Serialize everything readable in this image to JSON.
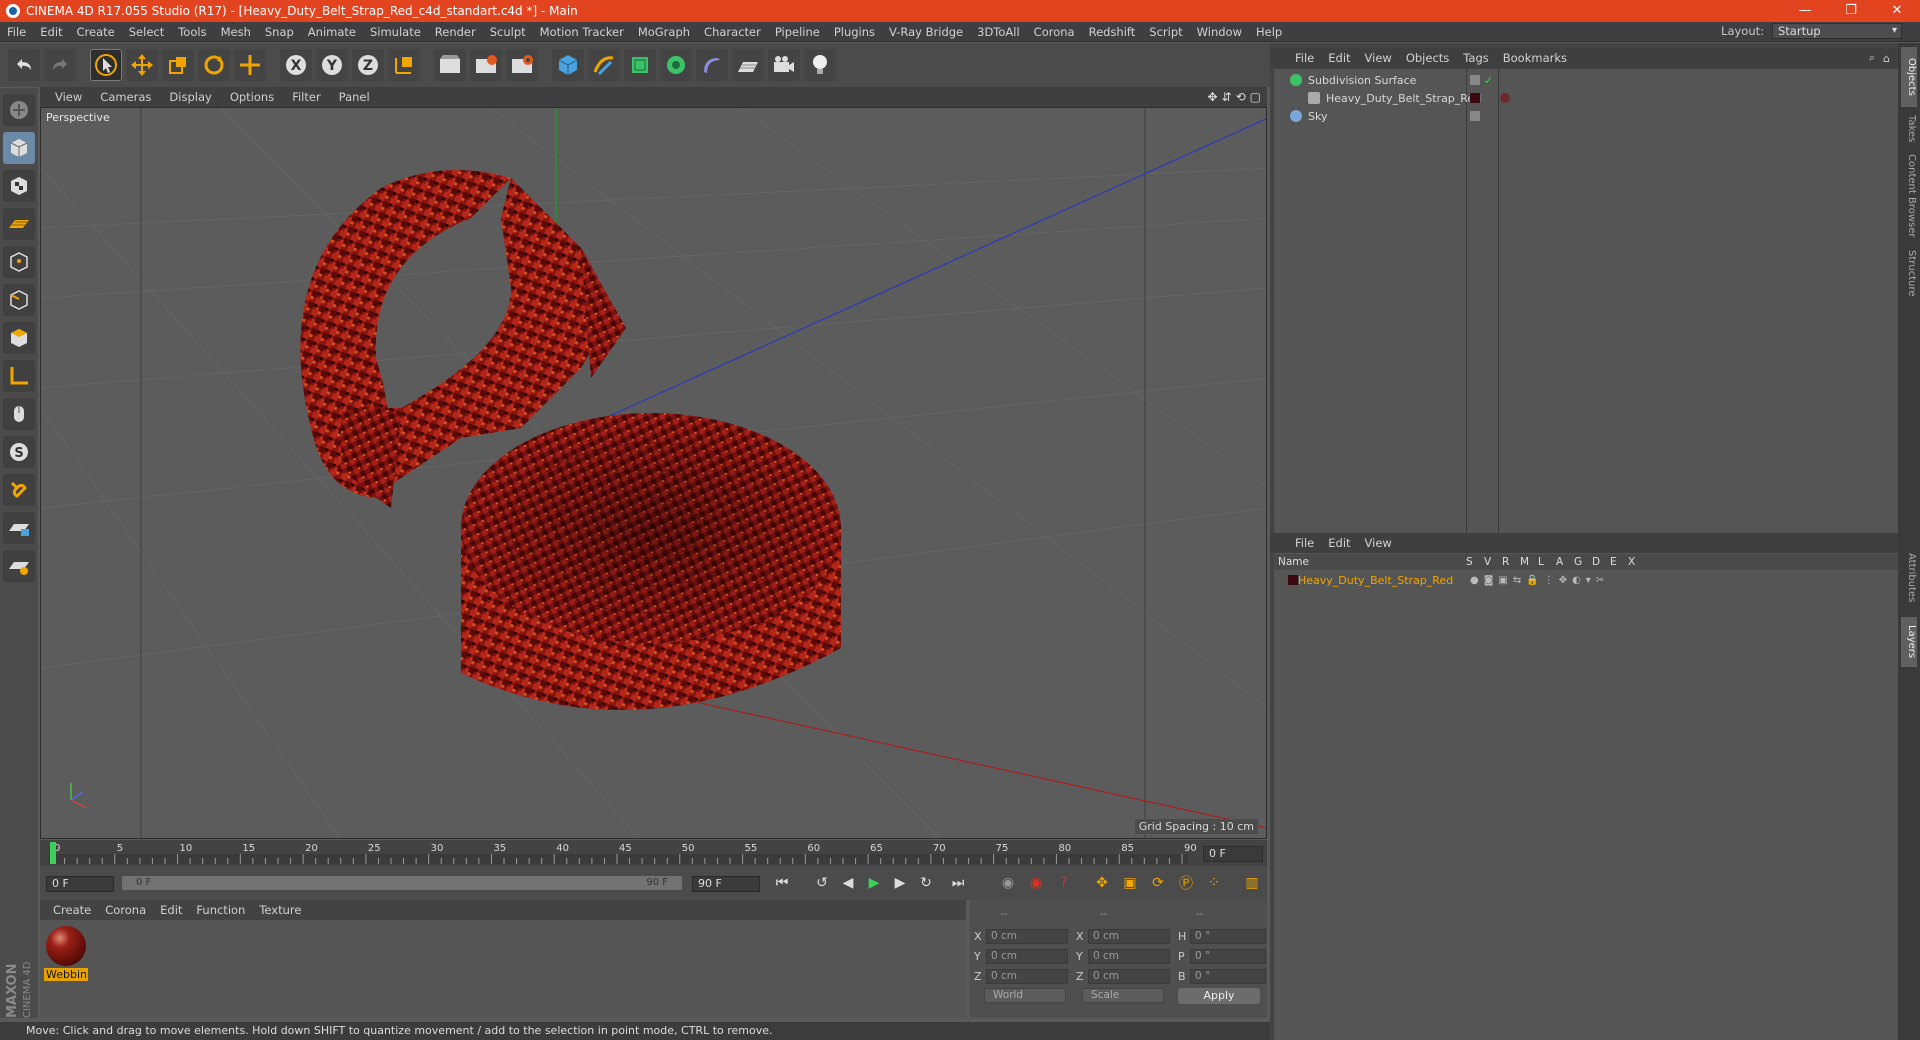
{
  "titlebar": {
    "title": "CINEMA 4D R17.055 Studio (R17) - [Heavy_Duty_Belt_Strap_Red_c4d_standart.c4d *] - Main",
    "controls": [
      "—",
      "❐",
      "✕"
    ]
  },
  "menubar": {
    "items": [
      "File",
      "Edit",
      "Create",
      "Select",
      "Tools",
      "Mesh",
      "Snap",
      "Animate",
      "Simulate",
      "Render",
      "Sculpt",
      "Motion Tracker",
      "MoGraph",
      "Character",
      "Pipeline",
      "Plugins",
      "V-Ray Bridge",
      "3DToAll",
      "Corona",
      "Redshift",
      "Script",
      "Window",
      "Help"
    ],
    "layout_label": "Layout:",
    "layout_value": "Startup"
  },
  "viewport": {
    "menu": [
      "View",
      "Cameras",
      "Display",
      "Options",
      "Filter",
      "Panel"
    ],
    "camera_label": "Perspective",
    "grid_spacing": "Grid Spacing : 10 cm",
    "nav_icons": [
      "✥",
      "⇵",
      "⟲",
      "▢"
    ]
  },
  "timeline": {
    "ticks": [
      "0",
      "5",
      "10",
      "15",
      "20",
      "25",
      "30",
      "35",
      "40",
      "45",
      "50",
      "55",
      "60",
      "65",
      "70",
      "75",
      "80",
      "85",
      "90"
    ],
    "current_frame": "0 F"
  },
  "playbar": {
    "start": "0 F",
    "range_start": "0 F",
    "range_end": "90 F",
    "end": "90 F"
  },
  "materials": {
    "menu": [
      "Create",
      "Corona",
      "Edit",
      "Function",
      "Texture"
    ],
    "items": [
      {
        "name": "Webbin"
      }
    ]
  },
  "coords": {
    "headers": [
      "--",
      "--",
      "--"
    ],
    "rows": [
      {
        "a": "X",
        "av": "0 cm",
        "b": "X",
        "bv": "0 cm",
        "c": "H",
        "cv": "0 °"
      },
      {
        "a": "Y",
        "av": "0 cm",
        "b": "Y",
        "bv": "0 cm",
        "c": "P",
        "cv": "0 °"
      },
      {
        "a": "Z",
        "av": "0 cm",
        "b": "Z",
        "bv": "0 cm",
        "c": "B",
        "cv": "0 °"
      }
    ],
    "mode1": "World",
    "mode2": "Scale",
    "apply": "Apply"
  },
  "objects": {
    "menu": [
      "File",
      "Edit",
      "View",
      "Objects",
      "Tags",
      "Bookmarks"
    ],
    "tree": [
      {
        "name": "Subdivision Surface"
      },
      {
        "name": "Heavy_Duty_Belt_Strap_Red"
      },
      {
        "name": "Sky"
      }
    ]
  },
  "layers": {
    "menu": [
      "File",
      "Edit",
      "View"
    ],
    "columns": [
      "Name",
      "S",
      "V",
      "R",
      "M",
      "L",
      "A",
      "G",
      "D",
      "E",
      "X"
    ],
    "rows": [
      {
        "name": "Heavy_Duty_Belt_Strap_Red"
      }
    ]
  },
  "sidetabs": [
    "Objects",
    "Takes",
    "Content Browser",
    "Structure",
    "Attributes",
    "Layers"
  ],
  "status": "Move: Click and drag to move elements. Hold down SHIFT to quantize movement / add to the selection in point mode, CTRL to remove.",
  "brand": {
    "line1": "MAXON",
    "line2": "CINEMA 4D"
  },
  "colors": {
    "title_bg": "#e34420",
    "accent": "#f0a500",
    "belt": "#8a1410"
  }
}
